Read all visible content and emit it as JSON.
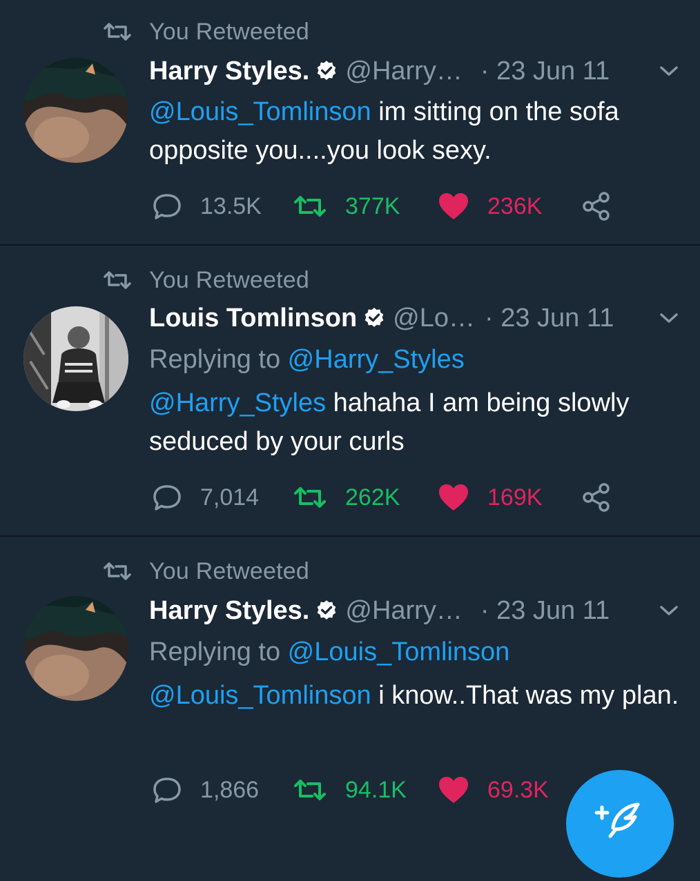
{
  "tweets": [
    {
      "retweet_label": "You Retweeted",
      "name": "Harry Styles.",
      "handle": "@Harry…",
      "date": "· 23 Jun 11",
      "replying_prefix": "",
      "replying_to": "",
      "mention": "@Louis_Tomlinson",
      "text": " im sitting on the sofa opposite you....you look sexy.",
      "replies": "13.5K",
      "retweets": "377K",
      "likes": "236K",
      "liked": true,
      "retweeted": true
    },
    {
      "retweet_label": "You Retweeted",
      "name": "Louis Tomlinson",
      "handle": "@Lo…",
      "date": "· 23 Jun 11",
      "replying_prefix": "Replying to ",
      "replying_to": "@Harry_Styles",
      "mention": "@Harry_Styles",
      "text": " hahaha I am being slowly seduced by your curls",
      "replies": "7,014",
      "retweets": "262K",
      "likes": "169K",
      "liked": true,
      "retweeted": true
    },
    {
      "retweet_label": "You Retweeted",
      "name": "Harry Styles.",
      "handle": "@Harry…",
      "date": "· 23 Jun 11",
      "replying_prefix": "Replying to ",
      "replying_to": "@Louis_Tomlinson",
      "mention": "@Louis_Tomlinson",
      "text": " i know..That was my plan.",
      "replies": "1,866",
      "retweets": "94.1K",
      "likes": "69.3K",
      "liked": true,
      "retweeted": true
    }
  ],
  "colors": {
    "background": "#1b2836",
    "mention": "#1da1f2",
    "secondary_text": "#8899a6",
    "retweet_green": "#17bf63",
    "like_pink": "#e0245e"
  },
  "icons": {
    "retweet_label": "retweet-icon",
    "verified": "verified-badge-icon",
    "menu": "chevron-down-icon",
    "reply": "reply-icon",
    "retweet": "retweet-icon",
    "like": "heart-icon",
    "share": "share-icon",
    "compose": "compose-tweet-icon"
  }
}
